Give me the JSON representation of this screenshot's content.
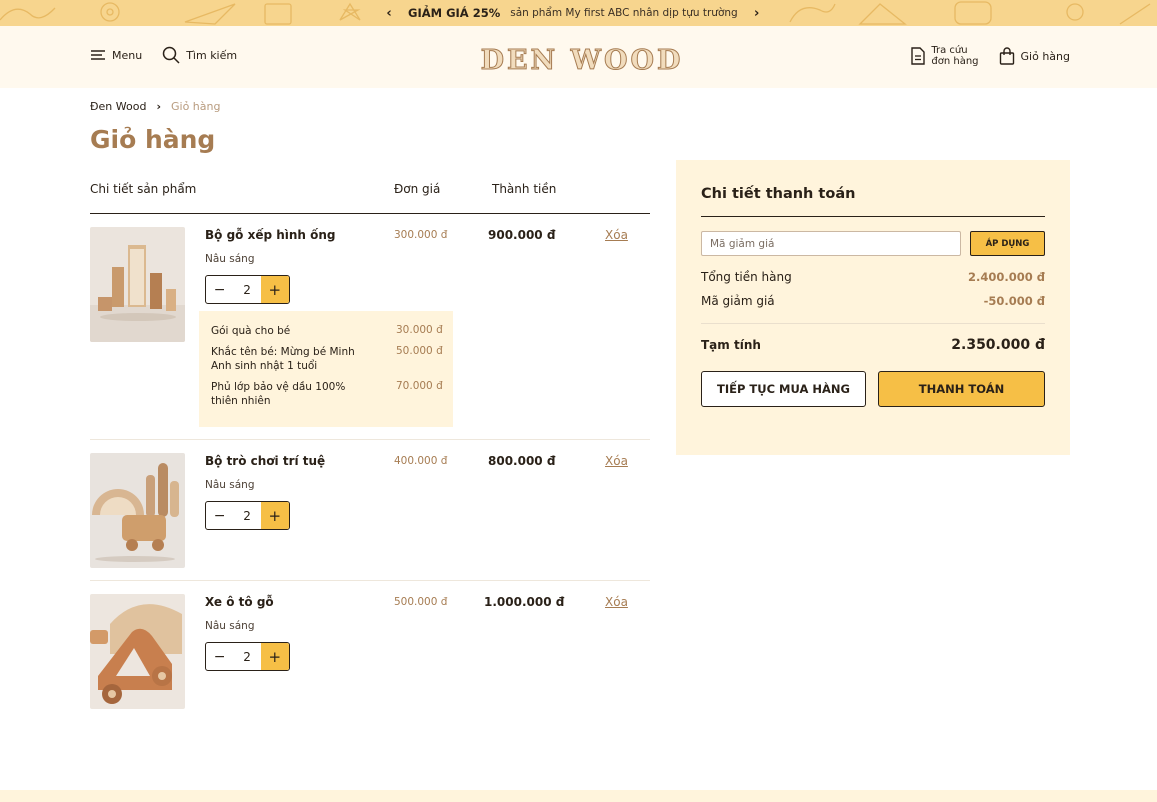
{
  "promo": {
    "highlight": "GIẢM GIÁ 25%",
    "text": "sản phẩm My first ABC nhân dịp tựu trường",
    "prev_icon": "chevron-left-icon",
    "next_icon": "chevron-right-icon"
  },
  "header": {
    "menu_label": "Menu",
    "search_label": "Tìm kiếm",
    "logo_text": "DEN WOOD",
    "order_lookup_line1": "Tra cứu",
    "order_lookup_line2": "đơn hàng",
    "cart_label": "Giỏ hàng"
  },
  "breadcrumb": {
    "home": "Đen Wood",
    "current": "Giỏ hàng"
  },
  "page_title": "Giỏ hàng",
  "table_headers": {
    "product": "Chi tiết sản phẩm",
    "unit_price": "Đơn giá",
    "total": "Thành tiền"
  },
  "items": [
    {
      "name": "Bộ gỗ xếp hình ống",
      "variant": "Nâu sáng",
      "unit_price": "300.000 đ",
      "total": "900.000 đ",
      "quantity": "2",
      "remove_label": "Xóa",
      "extras": [
        {
          "label": "Gói quà cho bé",
          "price": "30.000 đ"
        },
        {
          "label": "Khắc tên bé: Mừng bé Minh Anh sinh nhật 1 tuổi",
          "price": "50.000 đ"
        },
        {
          "label": "Phủ lớp bảo vệ dầu 100% thiên nhiên",
          "price": "70.000 đ"
        }
      ]
    },
    {
      "name": "Bộ trò chơi trí tuệ",
      "variant": "Nâu sáng",
      "unit_price": "400.000 đ",
      "total": "800.000 đ",
      "quantity": "2",
      "remove_label": "Xóa"
    },
    {
      "name": "Xe ô tô gỗ",
      "variant": "Nâu sáng",
      "unit_price": "500.000 đ",
      "total": "1.000.000 đ",
      "quantity": "2",
      "remove_label": "Xóa"
    }
  ],
  "payment": {
    "title": "Chi tiết thanh toán",
    "coupon_placeholder": "Mã giảm giá",
    "apply_label": "ÁP DỤNG",
    "goods_total_label": "Tổng tiền hàng",
    "goods_total_value": "2.400.000 đ",
    "discount_label": "Mã giảm giá",
    "discount_value": "-50.000 đ",
    "subtotal_label": "Tạm tính",
    "subtotal_value": "2.350.000 đ",
    "continue_label": "TIẾP TỤC MUA HÀNG",
    "checkout_label": "THANH TOÁN"
  },
  "colors": {
    "accent": "#f6bf46",
    "brand_brown": "#a67c52",
    "promo_bg": "#f7d58e",
    "panel_bg": "#fff4dc"
  }
}
